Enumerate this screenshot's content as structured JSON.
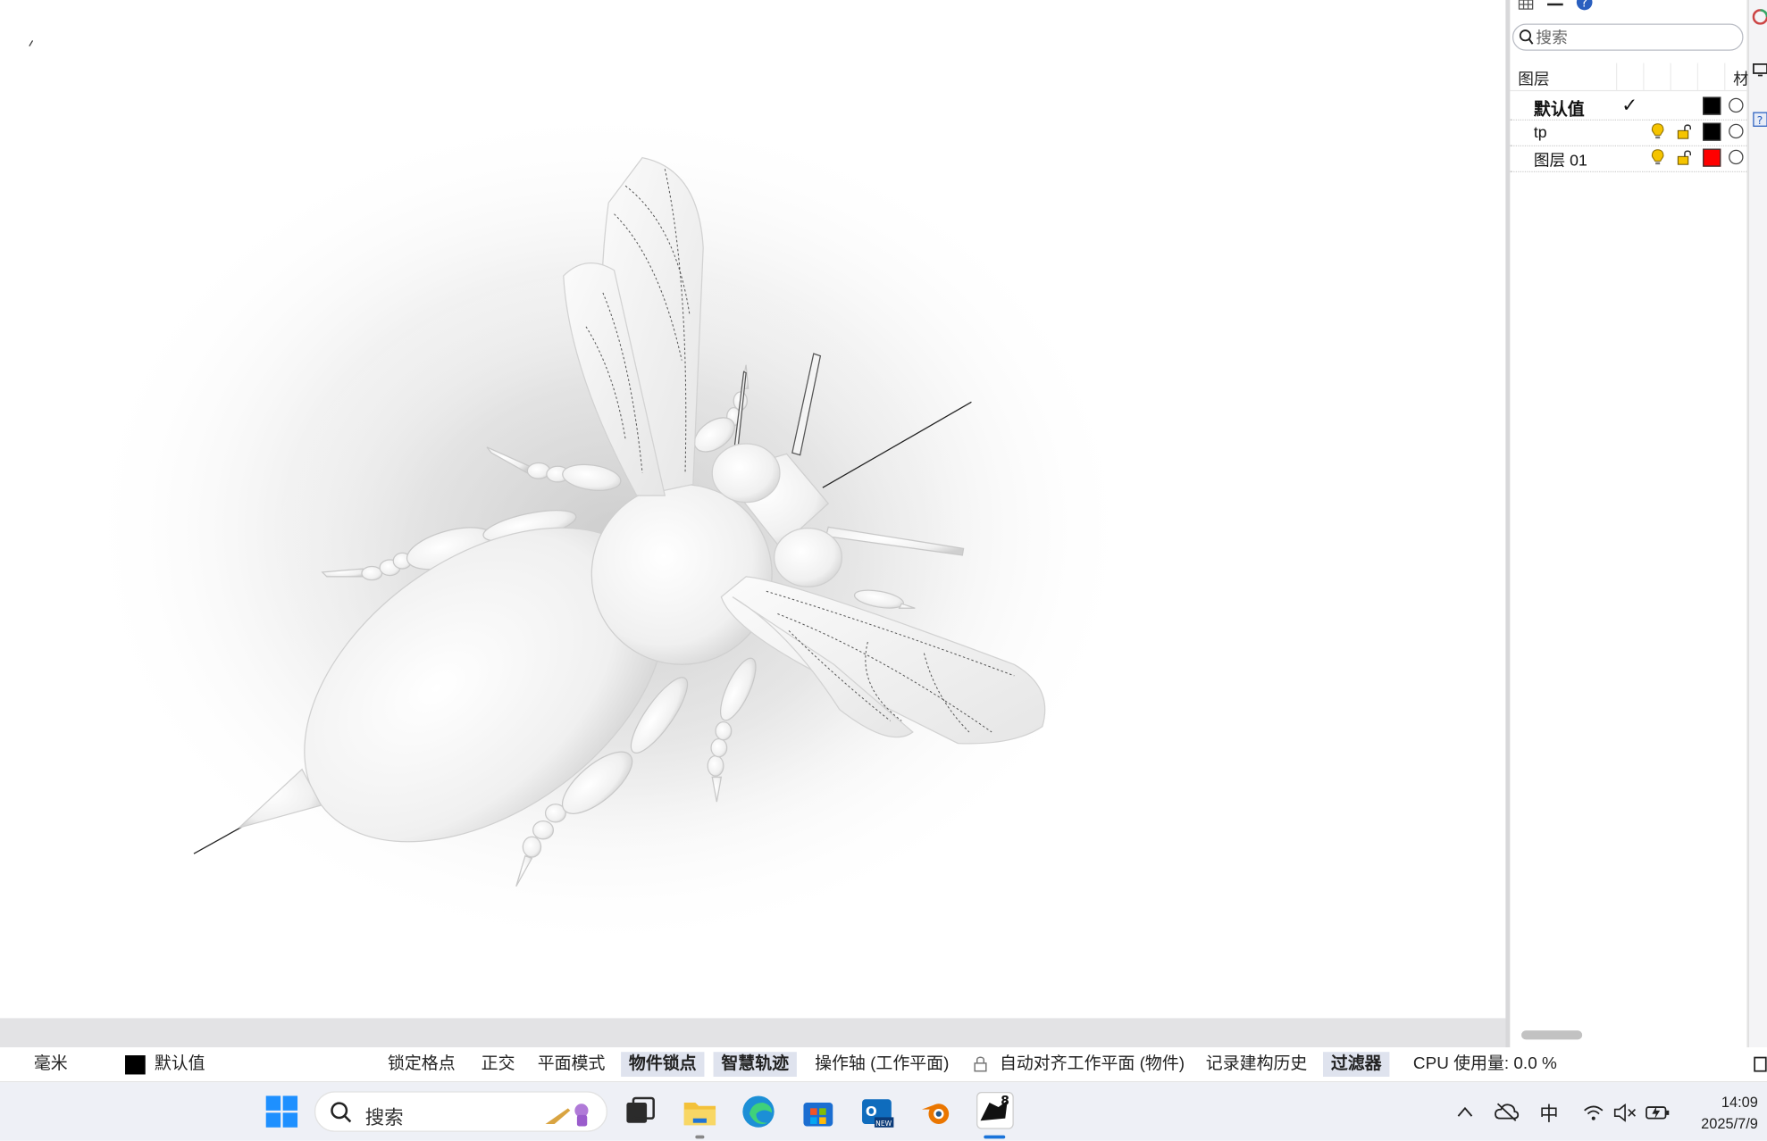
{
  "layers_panel": {
    "search_placeholder": "搜索",
    "header_layer": "图层",
    "header_material": "材",
    "rows": [
      {
        "name": "默认值",
        "current": true,
        "color": "#000000"
      },
      {
        "name": "tp",
        "current": false,
        "color": "#000000"
      },
      {
        "name": "图层 01",
        "current": false,
        "color": "#ff0000"
      }
    ],
    "current_mark": "✓"
  },
  "status_bar": {
    "units": "毫米",
    "current_layer": "默认值",
    "grid_snap": "锁定格点",
    "ortho": "正交",
    "planar": "平面模式",
    "osnap": "物件锁点",
    "smarttrack": "智慧轨迹",
    "gumball": "操作轴 (工作平面)",
    "autocplane": "自动对齐工作平面 (物件)",
    "record_history": "记录建构历史",
    "filter": "过滤器",
    "cpu": "CPU 使用量: 0.0 %"
  },
  "taskbar": {
    "search_label": "搜索",
    "ime": "中",
    "time": "14:09",
    "date": "2025/7/9"
  },
  "colors": {
    "accent_active": "#dfe3ee",
    "taskbar_bg": "#eef0f6"
  }
}
